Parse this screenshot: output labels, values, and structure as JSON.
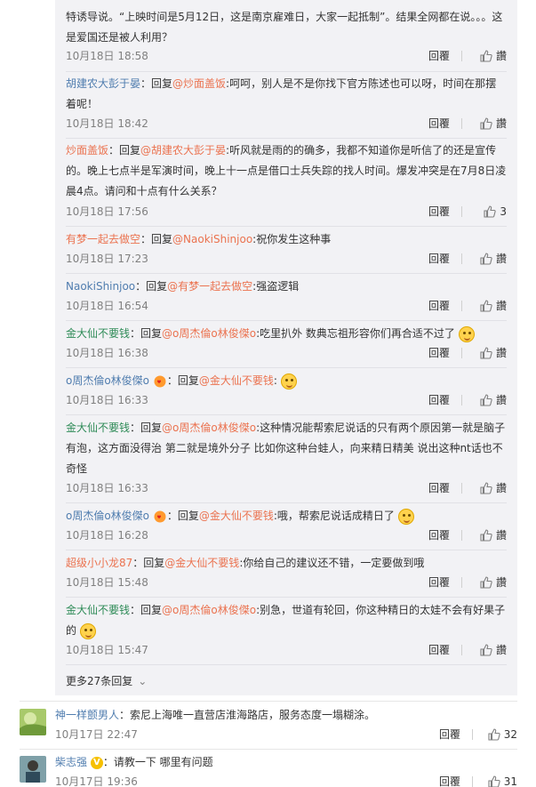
{
  "replies": [
    {
      "text_user": "",
      "text_segments": [
        "特诱导说。“上映时间是5月12日，这是南京雇难日，大家一起抵制”。结果全网都在说。。。这是爱国还是被人利用？"
      ],
      "time": "10月18日 18:58",
      "reply": "回覆",
      "like": "讚"
    },
    {
      "user": "胡建农大彭于晏",
      "mid": "：回复",
      "at": "@炒面盖饭",
      "text": ":呵呵，别人是不是你找下官方陈述也可以呀，时间在那摆着呢！",
      "time": "10月18日 18:42",
      "reply": "回覆",
      "like": "讚"
    },
    {
      "user": "炒面盖饭",
      "mid": "：回复",
      "at": "@胡建农大彭于晏",
      "text": ":听风就是雨的的确多，我都不知道你是听信了的还是宣传的。晚上七点半是军演时间，晚上十一点是借口士兵失踪的找人时间。爆发冲突是在7月8日凌晨4点。请问和十点有什么关系？",
      "time": "10月18日 17:56",
      "reply": "回覆",
      "like": "3"
    },
    {
      "user": "有梦一起去做空",
      "mid": "：回复",
      "at": "@NaokiShinjoo",
      "text": ":祝你发生这种事",
      "time": "10月18日 17:23",
      "reply": "回覆",
      "like": "讚"
    },
    {
      "user": "NaokiShinjoo",
      "mid": "：回复",
      "at": "@有梦一起去做空",
      "text": ":强盗逻辑",
      "time": "10月18日 16:54",
      "reply": "回覆",
      "like": "讚"
    },
    {
      "user": "金大仙不要钱",
      "mid": "：回复",
      "at": "@o周杰倫o林俊傑o",
      "text": ":吃里扒外 数典忘祖形容你们再合适不过了",
      "time": "10月18日 16:38",
      "reply": "回覆",
      "like": "讚"
    },
    {
      "user": "o周杰倫o林俊傑o",
      "mid": "：回复",
      "at": "@金大仙不要钱",
      "text": ":",
      "time": "10月18日 16:33",
      "reply": "回覆",
      "like": "讚"
    },
    {
      "user": "金大仙不要钱",
      "mid": "：回复",
      "at": "@o周杰倫o林俊傑o",
      "text": ":这种情况能帮索尼说话的只有两个原因第一就是脑子有泡，这方面没得治 第二就是境外分子 比如你这种台蛙人，向来精日精美 说出这种nt话也不奇怪",
      "time": "10月18日 16:33",
      "reply": "回覆",
      "like": "讚"
    },
    {
      "user": "o周杰倫o林俊傑o",
      "mid": "：回复",
      "at": "@金大仙不要钱",
      "text": ":哦，帮索尼说话成精日了",
      "time": "10月18日 16:28",
      "reply": "回覆",
      "like": "讚"
    },
    {
      "user": "超级小小龙87",
      "mid": "：回复",
      "at": "@金大仙不要钱",
      "text": ":你给自己的建议还不错，一定要做到哦",
      "time": "10月18日 15:48",
      "reply": "回覆",
      "like": "讚"
    },
    {
      "user": "金大仙不要钱",
      "mid": "：回复",
      "at": "@o周杰倫o林俊傑o",
      "text": ":别急，世道有轮回，你这种精日的太娃不会有好果子的",
      "time": "10月18日 15:47",
      "reply": "回覆",
      "like": "讚"
    }
  ],
  "more_replies": "更多27条回复",
  "comments": [
    {
      "user": "神一样颤男人",
      "text": "：索尼上海唯一直营店淮海路店，服务态度一塌糊涂。",
      "time": "10月17日 22:47",
      "reply": "回覆",
      "like": "32"
    },
    {
      "user": "柴志强",
      "text": "：请教一下 哪里有问题",
      "time": "10月17日 19:36",
      "reply": "回覆",
      "like": "31"
    }
  ]
}
